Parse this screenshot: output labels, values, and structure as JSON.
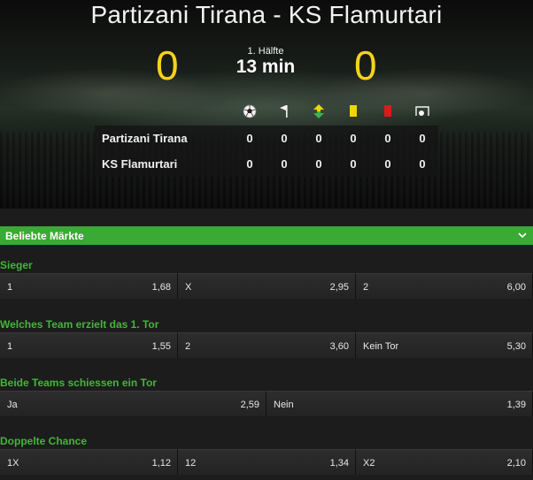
{
  "match": {
    "title": "Partizani Tirana - KS Flamurtari",
    "home_score": "0",
    "away_score": "0",
    "period": "1. Hälfte",
    "minute": "13 min"
  },
  "stats": {
    "icons": [
      "ball-icon",
      "corner-flag-icon",
      "substitution-icon",
      "yellow-card-icon",
      "red-card-icon",
      "penalty-icon"
    ],
    "rows": [
      {
        "team": "Partizani Tirana",
        "values": [
          "0",
          "0",
          "0",
          "0",
          "0",
          "0"
        ]
      },
      {
        "team": "KS Flamurtari",
        "values": [
          "0",
          "0",
          "0",
          "0",
          "0",
          "0"
        ]
      }
    ]
  },
  "colors": {
    "accent": "#3aa935",
    "score": "#f7d21a",
    "yellow_card": "#f2d600",
    "red_card": "#d81b1b"
  },
  "markets_header": "Beliebte Märkte",
  "markets": [
    {
      "title": "Sieger",
      "odds": [
        {
          "label": "1",
          "value": "1,68"
        },
        {
          "label": "X",
          "value": "2,95"
        },
        {
          "label": "2",
          "value": "6,00"
        }
      ]
    },
    {
      "title": "Welches Team erzielt das 1. Tor",
      "odds": [
        {
          "label": "1",
          "value": "1,55"
        },
        {
          "label": "2",
          "value": "3,60"
        },
        {
          "label": "Kein Tor",
          "value": "5,30"
        }
      ]
    },
    {
      "title": "Beide Teams schiessen ein Tor",
      "odds": [
        {
          "label": "Ja",
          "value": "2,59"
        },
        {
          "label": "Nein",
          "value": "1,39"
        }
      ]
    },
    {
      "title": "Doppelte Chance",
      "odds": [
        {
          "label": "1X",
          "value": "1,12"
        },
        {
          "label": "12",
          "value": "1,34"
        },
        {
          "label": "X2",
          "value": "2,10"
        }
      ]
    }
  ]
}
